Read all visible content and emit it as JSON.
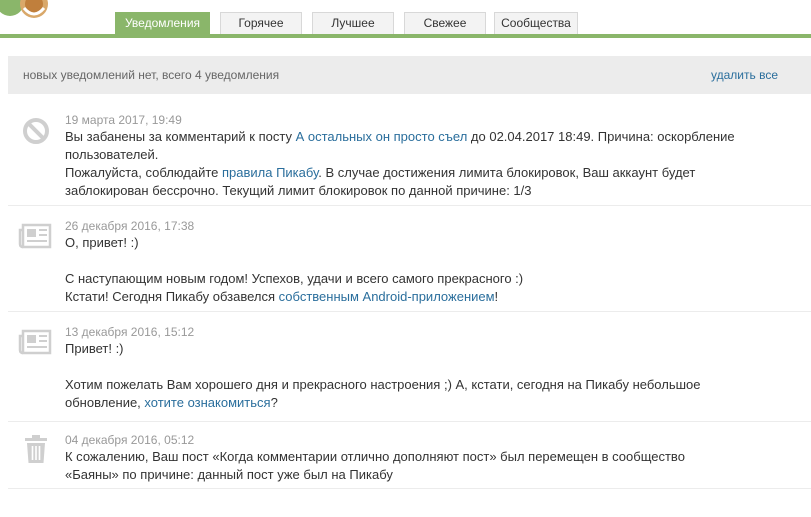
{
  "colors": {
    "accent_green": "#8ab66a",
    "link": "#2a6e9c",
    "summary_bg": "#ececec"
  },
  "tabs": [
    {
      "label": "Уведомления",
      "active": true
    },
    {
      "label": "Горячее",
      "active": false
    },
    {
      "label": "Лучшее",
      "active": false
    },
    {
      "label": "Свежее",
      "active": false
    },
    {
      "label": "Сообщества",
      "active": false
    }
  ],
  "summary": {
    "text": "новых уведомлений нет, всего 4 уведомления",
    "delete_all": "удалить все"
  },
  "notifications": [
    {
      "icon": "ban-icon",
      "date": "19 марта 2017, 19:49",
      "l1_a": "Вы забанены за комментарий к посту ",
      "l1_link": "А остальных он просто съел",
      "l1_b": " до 02.04.2017 18:49. Причина: оскорбление",
      "l2": "пользователей.",
      "l3_a": "Пожалуйста, соблюдайте ",
      "l3_link": "правила Пикабу",
      "l3_b": ". В случае достижения лимита блокировок, Ваш аккаунт будет",
      "l4": "заблокирован бессрочно. Текущий лимит блокировок по данной причине: 1/3"
    },
    {
      "icon": "newspaper-icon",
      "date": "26 декабря 2016, 17:38",
      "l1": "О, привет! :)",
      "l2": "С наступающим новым годом! Успехов, удачи и всего самого прекрасного :)",
      "l3_a": "Кстати! Сегодня Пикабу обзавелся ",
      "l3_link": "собственным Android-приложением",
      "l3_b": "!"
    },
    {
      "icon": "newspaper-icon",
      "date": "13 декабря 2016, 15:12",
      "l1": "Привет! :)",
      "l2": "Хотим пожелать Вам хорошего дня и прекрасного настроения ;) А, кстати, сегодня на Пикабу небольшое",
      "l3_a": "обновление, ",
      "l3_link": "хотите ознакомиться",
      "l3_b": "?"
    },
    {
      "icon": "trash-icon",
      "date": "04 декабря 2016, 05:12",
      "l1": "К сожалению, Ваш пост «Когда комментарии отлично дополняют пост» был перемещен в сообщество",
      "l2": "«Баяны» по причине: данный пост уже был на Пикабу"
    }
  ]
}
